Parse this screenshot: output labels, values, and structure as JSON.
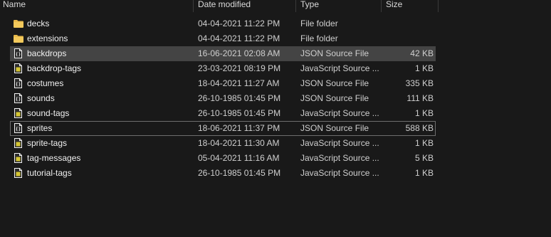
{
  "columns": {
    "name": "Name",
    "date": "Date modified",
    "type": "Type",
    "size": "Size"
  },
  "colors": {
    "folder": "#e8b94a",
    "json_doc": "#f2f2f2",
    "js_doc": "#f2f2f2",
    "js_badge": "#d4c532",
    "selected_bg": "#444444"
  },
  "files": [
    {
      "name": "decks",
      "date": "04-04-2021 11:22 PM",
      "type": "File folder",
      "size": "",
      "icon": "folder-icon"
    },
    {
      "name": "extensions",
      "date": "04-04-2021 11:22 PM",
      "type": "File folder",
      "size": "",
      "icon": "folder-icon"
    },
    {
      "name": "backdrops",
      "date": "16-06-2021 02:08 AM",
      "type": "JSON Source File",
      "size": "42 KB",
      "icon": "json-file-icon"
    },
    {
      "name": "backdrop-tags",
      "date": "23-03-2021 08:19 PM",
      "type": "JavaScript Source ...",
      "size": "1 KB",
      "icon": "js-file-icon"
    },
    {
      "name": "costumes",
      "date": "18-04-2021 11:27 AM",
      "type": "JSON Source File",
      "size": "335 KB",
      "icon": "json-file-icon"
    },
    {
      "name": "sounds",
      "date": "26-10-1985 01:45 PM",
      "type": "JSON Source File",
      "size": "111 KB",
      "icon": "json-file-icon"
    },
    {
      "name": "sound-tags",
      "date": "26-10-1985 01:45 PM",
      "type": "JavaScript Source ...",
      "size": "1 KB",
      "icon": "js-file-icon"
    },
    {
      "name": "sprites",
      "date": "18-06-2021 11:37 PM",
      "type": "JSON Source File",
      "size": "588 KB",
      "icon": "json-file-icon"
    },
    {
      "name": "sprite-tags",
      "date": "18-04-2021 11:30 AM",
      "type": "JavaScript Source ...",
      "size": "1 KB",
      "icon": "js-file-icon"
    },
    {
      "name": "tag-messages",
      "date": "05-04-2021 11:16 AM",
      "type": "JavaScript Source ...",
      "size": "5 KB",
      "icon": "js-file-icon"
    },
    {
      "name": "tutorial-tags",
      "date": "26-10-1985 01:45 PM",
      "type": "JavaScript Source ...",
      "size": "1 KB",
      "icon": "js-file-icon"
    }
  ]
}
